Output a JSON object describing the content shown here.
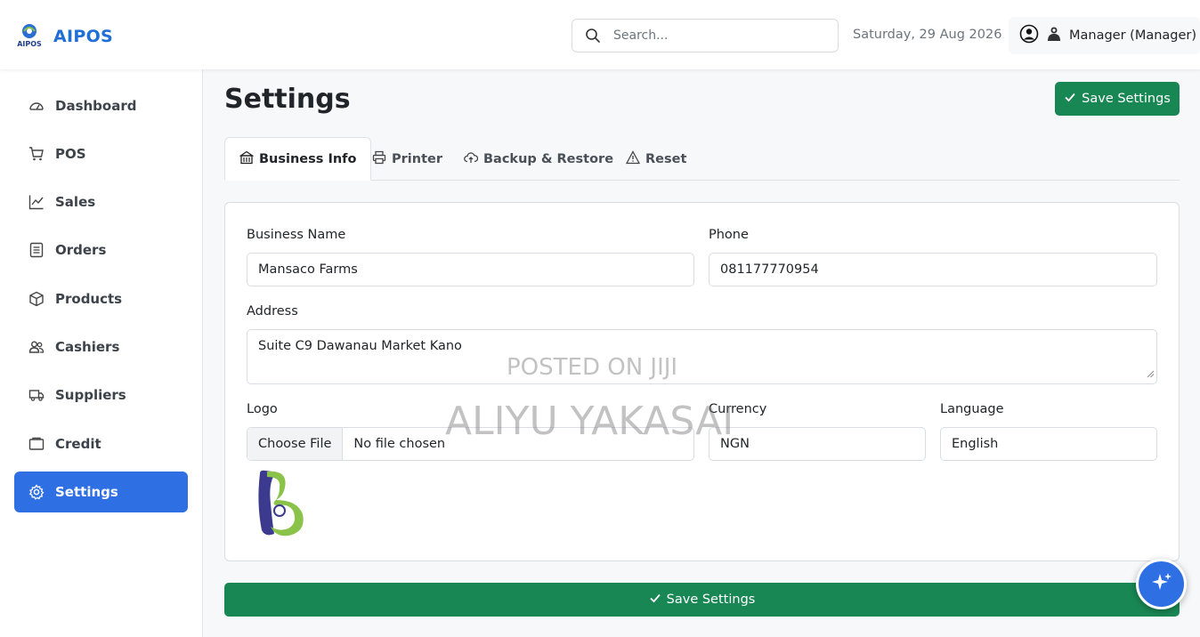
{
  "header": {
    "app_name": "AIPOS",
    "logo_text": "AIPOS",
    "search_placeholder": "Search...",
    "date": "Saturday, 29 Aug 2026",
    "user": "Manager (Manager)"
  },
  "sidebar": {
    "items": [
      {
        "label": "Dashboard",
        "icon": "dashboard-icon"
      },
      {
        "label": "POS",
        "icon": "cart-icon"
      },
      {
        "label": "Sales",
        "icon": "chart-line-icon"
      },
      {
        "label": "Orders",
        "icon": "list-icon"
      },
      {
        "label": "Products",
        "icon": "box-icon"
      },
      {
        "label": "Cashiers",
        "icon": "people-icon"
      },
      {
        "label": "Suppliers",
        "icon": "truck-icon"
      },
      {
        "label": "Credit",
        "icon": "wallet-icon"
      },
      {
        "label": "Settings",
        "icon": "gear-icon",
        "active": true
      }
    ]
  },
  "page": {
    "title": "Settings",
    "save_label": "Save Settings"
  },
  "tabs": [
    {
      "label": "Business Info",
      "icon": "building-icon",
      "active": true
    },
    {
      "label": "Printer",
      "icon": "printer-icon"
    },
    {
      "label": "Backup & Restore",
      "icon": "cloud-upload-icon"
    },
    {
      "label": "Reset",
      "icon": "warning-icon"
    }
  ],
  "form": {
    "business_name_label": "Business Name",
    "business_name": "Mansaco Farms",
    "phone_label": "Phone",
    "phone": "081177770954",
    "address_label": "Address",
    "address": "Suite C9 Dawanau Market Kano",
    "logo_label": "Logo",
    "choose_file": "Choose File",
    "file_status": "No file chosen",
    "currency_label": "Currency",
    "currency": "NGN",
    "language_label": "Language",
    "language": "English"
  },
  "watermark": {
    "line1": "POSTED ON JIJI",
    "line2": "ALIYU YAKASAI"
  },
  "colors": {
    "primary": "#2f6fe4",
    "success": "#198754",
    "brand": "#1f6fd6"
  }
}
